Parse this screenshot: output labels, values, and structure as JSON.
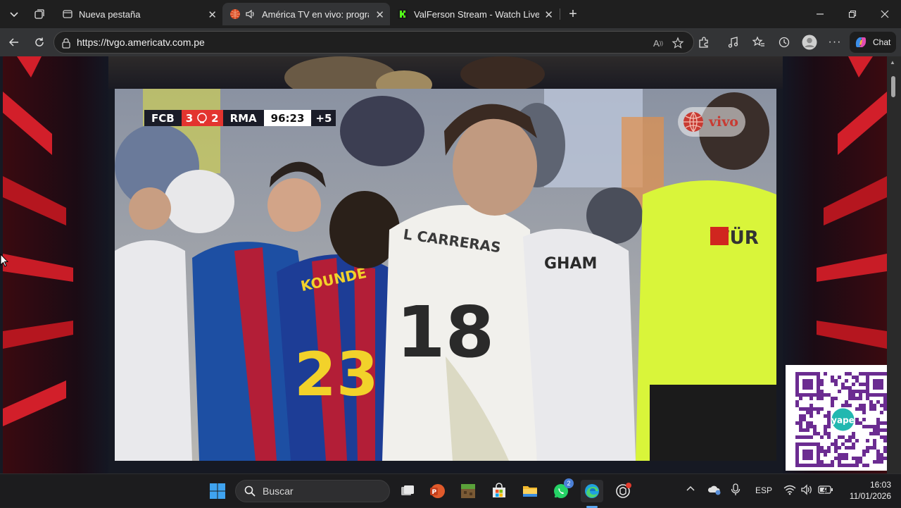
{
  "browser": {
    "tabs": [
      {
        "title": "Nueva pestaña",
        "active": false
      },
      {
        "title": "América TV en vivo: programa",
        "active": true
      },
      {
        "title": "ValFerson Stream - Watch Live on",
        "active": false
      }
    ],
    "new_tab_symbol": "+",
    "url": "https://tvgo.americatv.com.pe",
    "chat_label": "Chat"
  },
  "video": {
    "scorebug": {
      "home_team": "FCB",
      "home_score": "3",
      "away_score": "2",
      "away_team": "RMA",
      "clock": "96:23",
      "added_time": "+5"
    },
    "live_label": "vivo",
    "jersey_texts": [
      "L CARRERAS",
      "18",
      "GHAM",
      "23",
      "WÜR"
    ]
  },
  "taskbar": {
    "search_placeholder": "Buscar",
    "whatsapp_badge": "2",
    "language": "ESP",
    "time": "16:03",
    "date": "11/01/2026"
  },
  "colors": {
    "accent_red": "#e3342f",
    "brand_purple": "#6b2c91",
    "edge_blue": "#3b8ee8"
  }
}
